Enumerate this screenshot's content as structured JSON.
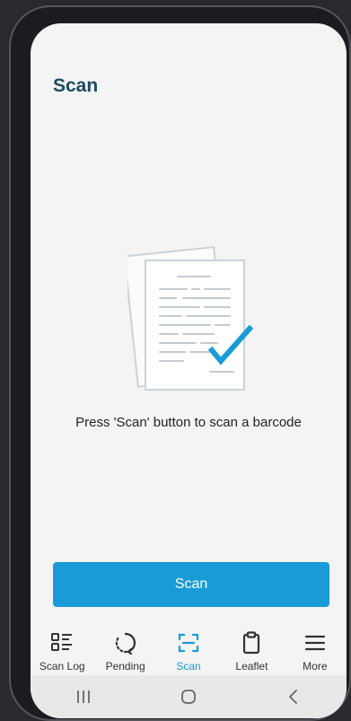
{
  "status_bar": {
    "time": "",
    "right": ""
  },
  "header": {
    "title": "Scan"
  },
  "main": {
    "hint": "Press 'Scan' button to scan a barcode",
    "illustration_icon": "document-checkmark-icon",
    "scan_button_label": "Scan"
  },
  "bottom_nav": {
    "active": "scan",
    "items": [
      {
        "label": "Scan Log",
        "icon": "scan-log-icon"
      },
      {
        "label": "Pending",
        "icon": "pending-icon"
      },
      {
        "label": "Scan",
        "icon": "scan-frame-icon"
      },
      {
        "label": "Leaflet",
        "icon": "clipboard-icon"
      },
      {
        "label": "More",
        "icon": "menu-icon"
      }
    ]
  },
  "system_nav": {
    "items": [
      "recent-apps-icon",
      "home-icon",
      "back-icon"
    ]
  },
  "colors": {
    "accent": "#1a9bd7",
    "title": "#1e4a5e",
    "background": "#f4f4f4"
  }
}
